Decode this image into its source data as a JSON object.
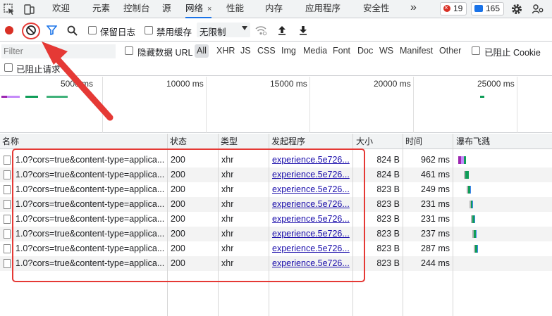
{
  "tabbar": {
    "tabs": [
      {
        "label": "欢迎"
      },
      {
        "label": "元素"
      },
      {
        "label": "控制台"
      },
      {
        "label": "源"
      },
      {
        "label": "网络",
        "close": "×"
      },
      {
        "label": "性能"
      },
      {
        "label": "内存"
      },
      {
        "label": "应用程序"
      },
      {
        "label": "安全性"
      }
    ],
    "more_label": "»",
    "error_count": "19",
    "message_count": "165"
  },
  "toolbar": {
    "preserve_log_label": "保留日志",
    "disable_cache_label": "禁用缓存",
    "throttling_value": "无限制"
  },
  "filterbar": {
    "placeholder": "Filter",
    "hide_data_url_label": "隐藏数据 URL",
    "types": [
      "All",
      "XHR",
      "JS",
      "CSS",
      "Img",
      "Media",
      "Font",
      "Doc",
      "WS",
      "Manifest",
      "Other"
    ],
    "blocked_cookies_label": "已阻止 Cookie",
    "blocked_requests_label": "已阻止请求"
  },
  "overview": {
    "ticks": [
      "5000 ms",
      "10000 ms",
      "15000 ms",
      "20000 ms",
      "25000 ms"
    ]
  },
  "table": {
    "columns": [
      "名称",
      "状态",
      "类型",
      "发起程序",
      "大小",
      "时间",
      "瀑布飞溅"
    ],
    "rows": [
      {
        "name": "1.0?cors=true&content-type=applica...",
        "status": "200",
        "type": "xhr",
        "initiator": "experience.5e726...",
        "size": "824 B",
        "time": "962 ms"
      },
      {
        "name": "1.0?cors=true&content-type=applica...",
        "status": "200",
        "type": "xhr",
        "initiator": "experience.5e726...",
        "size": "824 B",
        "time": "461 ms"
      },
      {
        "name": "1.0?cors=true&content-type=applica...",
        "status": "200",
        "type": "xhr",
        "initiator": "experience.5e726...",
        "size": "823 B",
        "time": "249 ms"
      },
      {
        "name": "1.0?cors=true&content-type=applica...",
        "status": "200",
        "type": "xhr",
        "initiator": "experience.5e726...",
        "size": "823 B",
        "time": "231 ms"
      },
      {
        "name": "1.0?cors=true&content-type=applica...",
        "status": "200",
        "type": "xhr",
        "initiator": "experience.5e726...",
        "size": "823 B",
        "time": "231 ms"
      },
      {
        "name": "1.0?cors=true&content-type=applica...",
        "status": "200",
        "type": "xhr",
        "initiator": "experience.5e726...",
        "size": "823 B",
        "time": "237 ms"
      },
      {
        "name": "1.0?cors=true&content-type=applica...",
        "status": "200",
        "type": "xhr",
        "initiator": "experience.5e726...",
        "size": "823 B",
        "time": "287 ms"
      },
      {
        "name": "1.0?cors=true&content-type=applica...",
        "status": "200",
        "type": "xhr",
        "initiator": "experience.5e726...",
        "size": "823 B",
        "time": "244 ms"
      }
    ]
  },
  "colors": {
    "accent": "#1a73e8",
    "record": "#d93025",
    "annotation": "#e53935",
    "waterfall_wait": "#0f9d58",
    "waterfall_receive": "#4285f4"
  },
  "icons": [
    "inspect-icon",
    "device-toolbar-icon",
    "record-icon",
    "clear-icon",
    "filter-icon",
    "search-icon",
    "wifi-icon",
    "upload-icon",
    "download-icon",
    "gear-icon",
    "customize-icon"
  ]
}
